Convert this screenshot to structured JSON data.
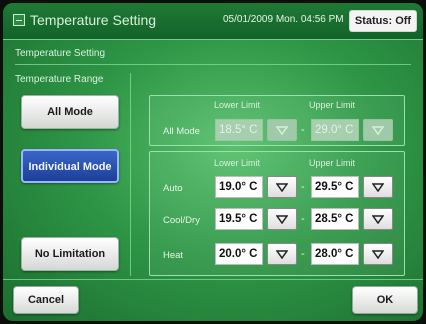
{
  "header": {
    "title": "Temperature Setting",
    "datetime": "05/01/2009 Mon. 04:56 PM",
    "status_label": "Status: Off"
  },
  "section_title": "Temperature Setting",
  "range_title": "Temperature Range",
  "modes": [
    {
      "label": "All Mode",
      "selected": false
    },
    {
      "label": "Individual Mode",
      "selected": true
    },
    {
      "label": "No Limitation",
      "selected": false
    }
  ],
  "all_mode": {
    "row_label": "All Mode",
    "lower_header": "Lower Limit",
    "upper_header": "Upper Limit",
    "lower": "18.5° C",
    "upper": "29.0° C",
    "enabled": false
  },
  "individual": {
    "lower_header": "Lower Limit",
    "upper_header": "Upper Limit",
    "rows": [
      {
        "label": "Auto",
        "lower": "19.0° C",
        "upper": "29.5° C"
      },
      {
        "label": "Cool/Dry",
        "lower": "19.5° C",
        "upper": "28.5° C"
      },
      {
        "label": "Heat",
        "lower": "20.0° C",
        "upper": "28.0° C"
      }
    ]
  },
  "separator": "-",
  "footer": {
    "cancel_label": "Cancel",
    "ok_label": "OK"
  },
  "colors": {
    "background": "#2f9747",
    "selected_button": "#1d3f99"
  }
}
